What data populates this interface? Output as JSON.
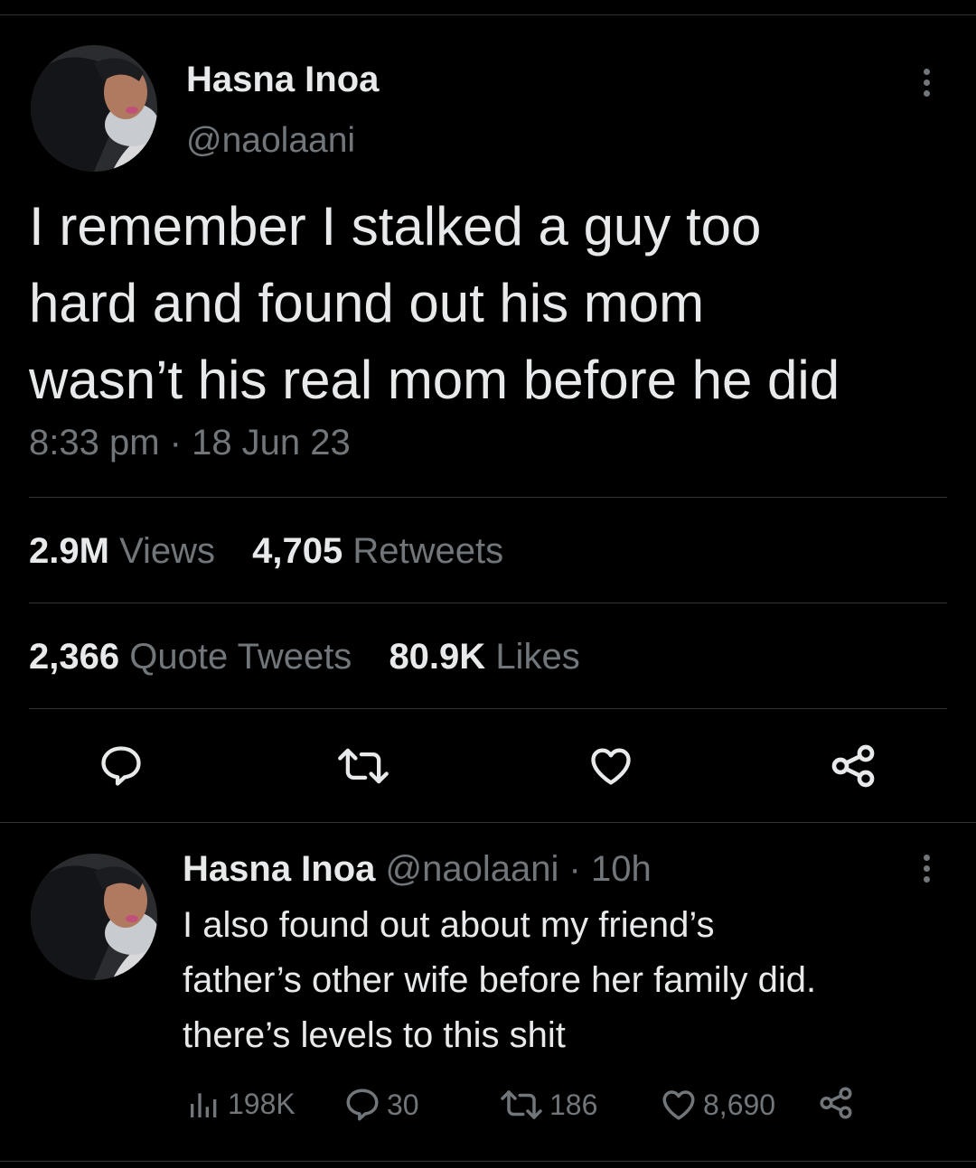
{
  "main_tweet": {
    "author_name": "Hasna Inoa",
    "author_handle": "@naolaani",
    "text_lines": [
      "I remember I stalked a guy too",
      "hard and found out his mom",
      "wasn’t his real mom before he did"
    ],
    "timestamp": "8:33 pm · 18 Jun 23",
    "stats": {
      "views_count": "2.9M",
      "views_label": "Views",
      "retweets_count": "4,705",
      "retweets_label": "Retweets",
      "quotes_count": "2,366",
      "quotes_label": "Quote Tweets",
      "likes_count": "80.9K",
      "likes_label": "Likes"
    },
    "actions": [
      "reply-icon",
      "retweet-icon",
      "like-icon",
      "share-icon"
    ]
  },
  "reply_tweet": {
    "author_name": "Hasna Inoa",
    "author_handle": "@naolaani",
    "time_ago": "· 10h",
    "text_lines": [
      "I also found out about my friend’s",
      "father’s other wife before her family did.",
      "there’s levels to this shit"
    ],
    "metrics": {
      "views": "198K",
      "replies": "30",
      "retweets": "186",
      "likes": "8,690"
    }
  },
  "colors": {
    "background": "#000000",
    "text_primary": "#e7e9ea",
    "text_secondary": "#71767b",
    "divider": "#2f3336"
  }
}
